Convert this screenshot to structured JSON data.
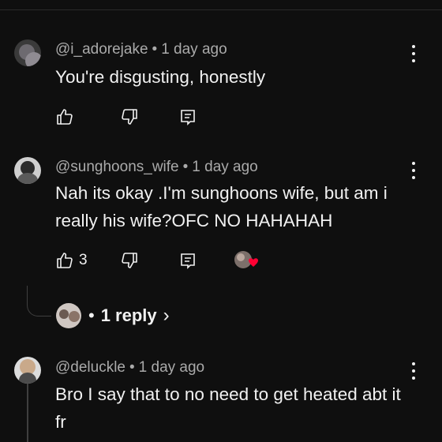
{
  "comments": [
    {
      "author": "@i_adorejake",
      "time": "1 day ago",
      "text": "You're disgusting, honestly",
      "likes": ""
    },
    {
      "author": "@sunghoons_wife",
      "time": "1 day ago",
      "text": "Nah its okay .I'm sunghoons wife, but am i really his wife?OFC NO HAHAHAH",
      "likes": "3",
      "creator_heart": true
    },
    {
      "author": "@deluckle",
      "time": "1 day ago",
      "text": "Bro I say that to no need to get heated abt it fr",
      "likes": ""
    }
  ],
  "replies": {
    "bullet": "•",
    "label": "1 reply"
  },
  "separator": "•",
  "icons": {
    "like": "thumbs-up-icon",
    "dislike": "thumbs-down-icon",
    "reply": "reply-comment-icon",
    "more": "kebab-menu-icon",
    "heart": "creator-heart-icon",
    "chevron": "chevron-right-icon"
  },
  "colors": {
    "background": "#0f0f0f",
    "text": "#f1f1f1",
    "meta": "#aaaaaa",
    "heart": "#ff0033"
  }
}
